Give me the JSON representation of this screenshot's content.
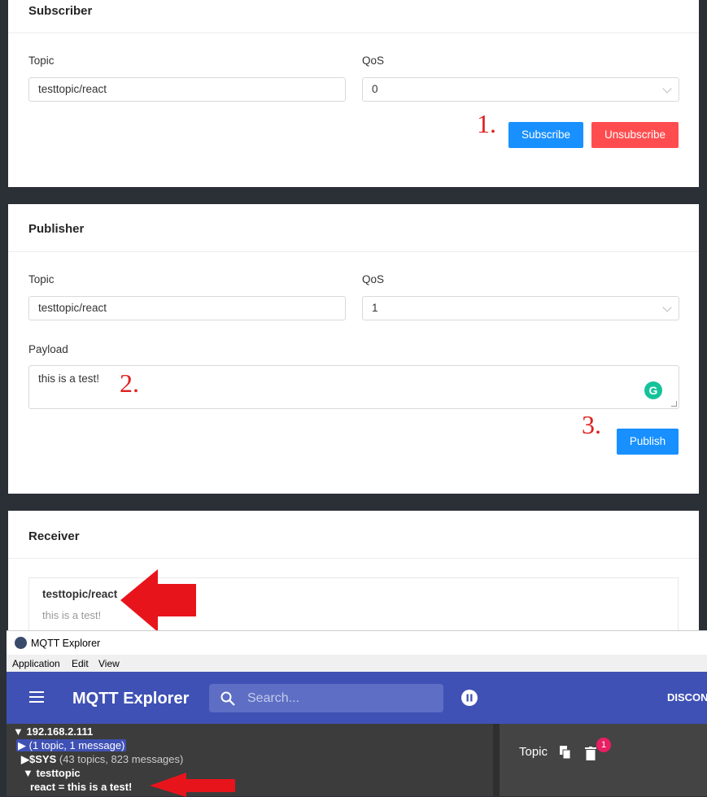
{
  "subscriber": {
    "title": "Subscriber",
    "topic_label": "Topic",
    "topic_value": "testtopic/react",
    "qos_label": "QoS",
    "qos_value": "0",
    "subscribe_label": "Subscribe",
    "unsubscribe_label": "Unsubscribe",
    "annotation": "1."
  },
  "publisher": {
    "title": "Publisher",
    "topic_label": "Topic",
    "topic_value": "testtopic/react",
    "qos_label": "QoS",
    "qos_value": "1",
    "payload_label": "Payload",
    "payload_value": "this is a test!",
    "payload_annotation": "2.",
    "publish_annotation": "3.",
    "publish_label": "Publish"
  },
  "receiver": {
    "title": "Receiver",
    "message_topic": "testtopic/react",
    "message_payload": "this is a test!"
  },
  "mqtt_explorer": {
    "window_title": "MQTT Explorer",
    "menu": [
      "Application",
      "Edit",
      "View"
    ],
    "brand": "MQTT Explorer",
    "search_placeholder": "Search...",
    "disconnect_label": "DISCON",
    "tree": {
      "host": "192.168.2.111",
      "summary": "(1 topic, 1 message)",
      "sys_name": "$SYS",
      "sys_count": "(43 topics, 823 messages)",
      "topic": "testtopic",
      "leaf": "react = this is a test!"
    },
    "right_topic_label": "Topic",
    "badge_count": "1"
  },
  "colors": {
    "primary": "#1890ff",
    "danger": "#ff4d4f",
    "mqtt_appbar": "#3f51b5",
    "annotation": "#e02020",
    "grammarly": "#15c39a"
  }
}
